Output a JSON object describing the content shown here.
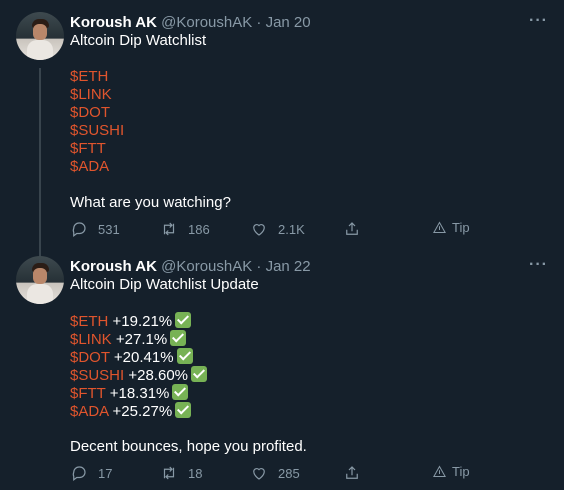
{
  "tweets": [
    {
      "name": "Koroush AK",
      "handle": "@KoroushAK",
      "sep": "·",
      "date": "Jan 20",
      "more_icon": "···",
      "title": "Altcoin Dip Watchlist",
      "tickers": [
        "$ETH",
        "$LINK",
        "$DOT",
        "$SUSHI",
        "$FTT",
        "$ADA"
      ],
      "footer": "What are you watching?",
      "reply_count": "531",
      "retweet_count": "186",
      "like_count": "2.1K",
      "tip_label": "Tip"
    },
    {
      "name": "Koroush AK",
      "handle": "@KoroushAK",
      "sep": "·",
      "date": "Jan 22",
      "more_icon": "···",
      "title": "Altcoin Dip Watchlist Update",
      "tickers": [
        {
          "symbol": "$ETH",
          "change": "+19.21%"
        },
        {
          "symbol": "$LINK",
          "change": "+27.1%"
        },
        {
          "symbol": "$DOT",
          "change": "+20.41%"
        },
        {
          "symbol": "$SUSHI",
          "change": "+28.60%"
        },
        {
          "symbol": "$FTT",
          "change": "+18.31%"
        },
        {
          "symbol": "$ADA",
          "change": "+25.27%"
        }
      ],
      "footer": "Decent bounces, hope you profited.",
      "reply_count": "17",
      "retweet_count": "18",
      "like_count": "285",
      "tip_label": "Tip"
    }
  ]
}
